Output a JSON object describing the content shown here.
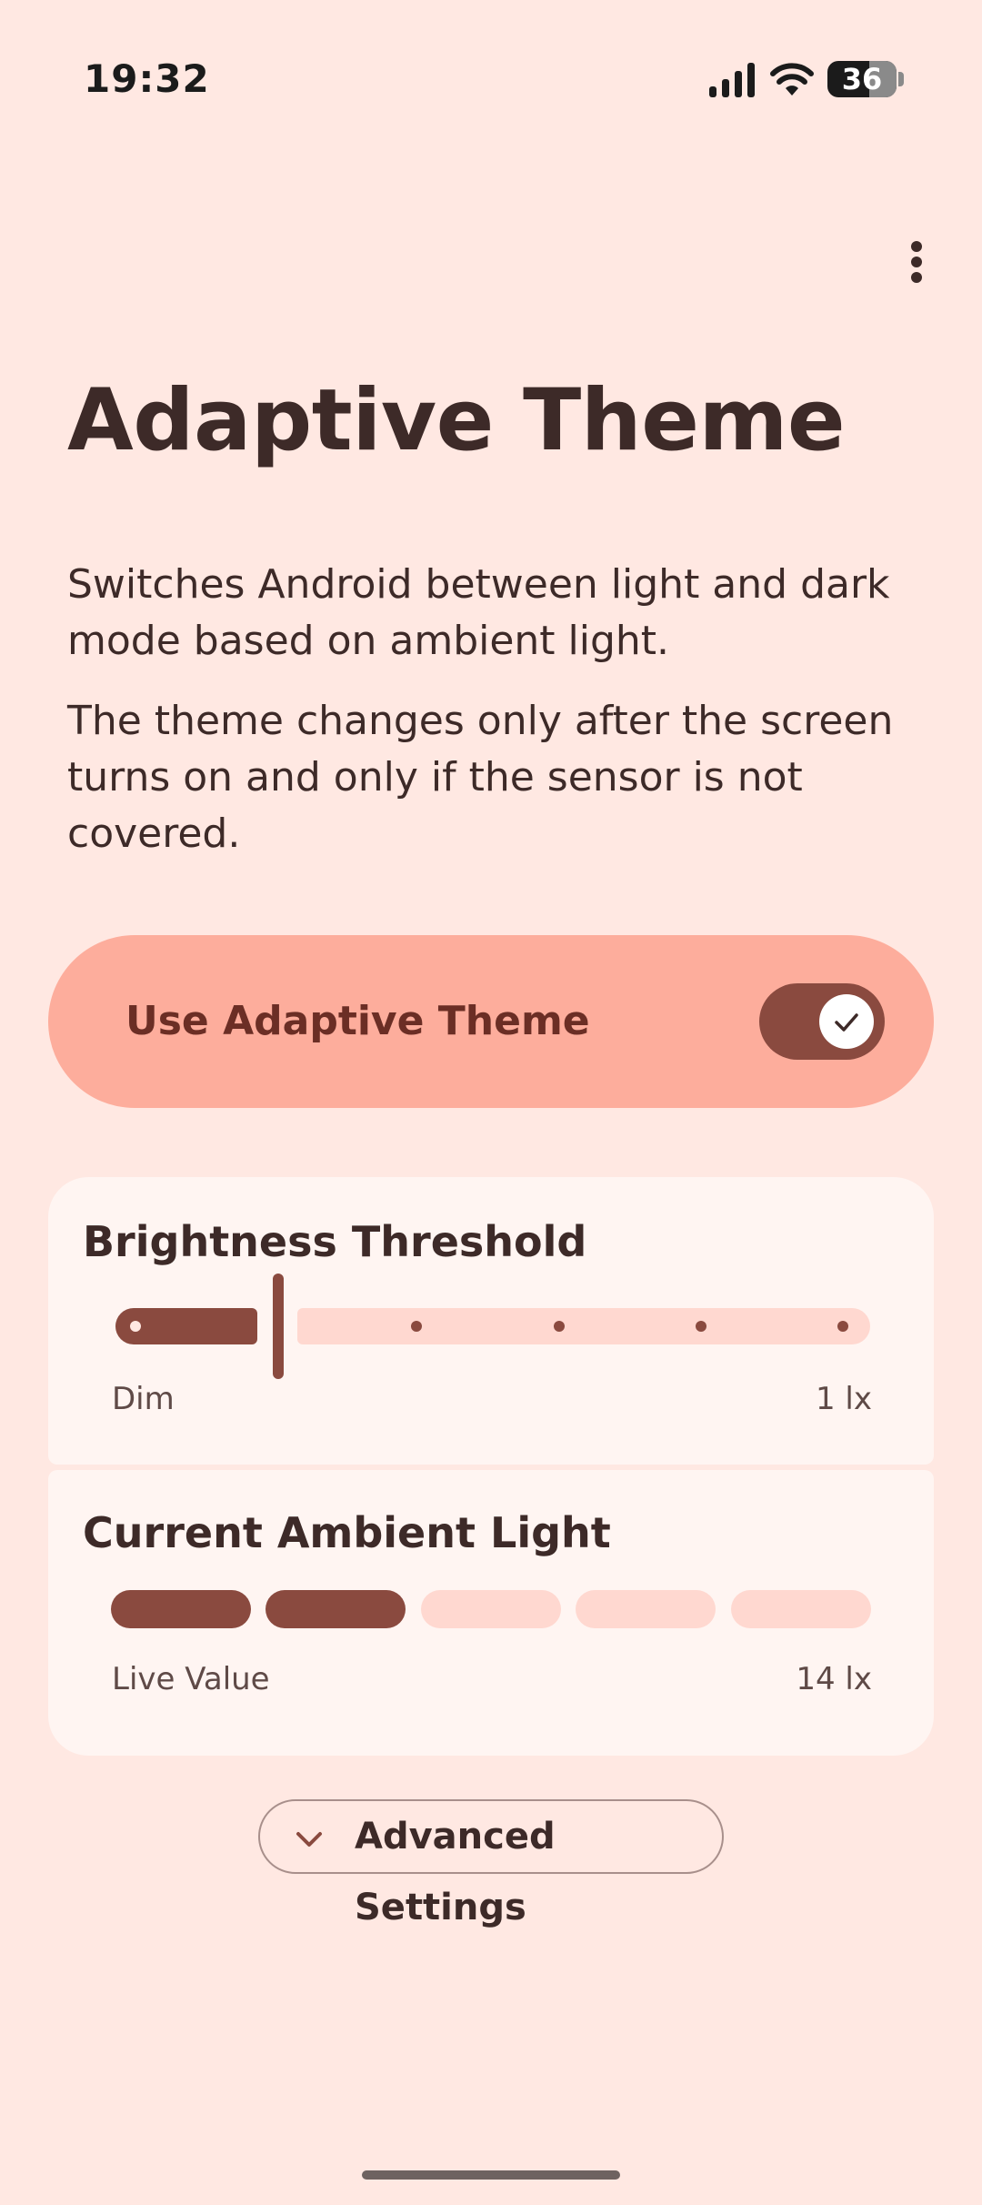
{
  "status_bar": {
    "time": "19:32",
    "battery_level": "36",
    "icons": [
      "signal-icon",
      "wifi-icon",
      "battery-icon"
    ]
  },
  "toolbar": {
    "menu_icon": "more-vert-icon"
  },
  "page": {
    "title": "Adaptive Theme",
    "description_1": "Switches Android between light and dark mode based on ambient light.",
    "description_2": "The theme changes only after the screen turns on and only if the sensor is not covered."
  },
  "main_switch": {
    "label": "Use Adaptive Theme",
    "checked": true
  },
  "brightness_threshold": {
    "title": "Brightness Threshold",
    "min_label": "Dim",
    "value_label": "1 lx",
    "steps": 6,
    "selected_step": 1
  },
  "ambient_light": {
    "title": "Current Ambient Light",
    "caption": "Live Value",
    "value_label": "14 lx",
    "segments_total": 5,
    "segments_filled": 2
  },
  "advanced": {
    "label": "Advanced Settings",
    "icon": "chevron-down-icon"
  },
  "colors": {
    "background": "#FFE8E2",
    "accent": "#8A4A3F",
    "switch_container": "#FDAD9C",
    "card": "#FFF5F2",
    "track_inactive": "#FFD8D0"
  }
}
